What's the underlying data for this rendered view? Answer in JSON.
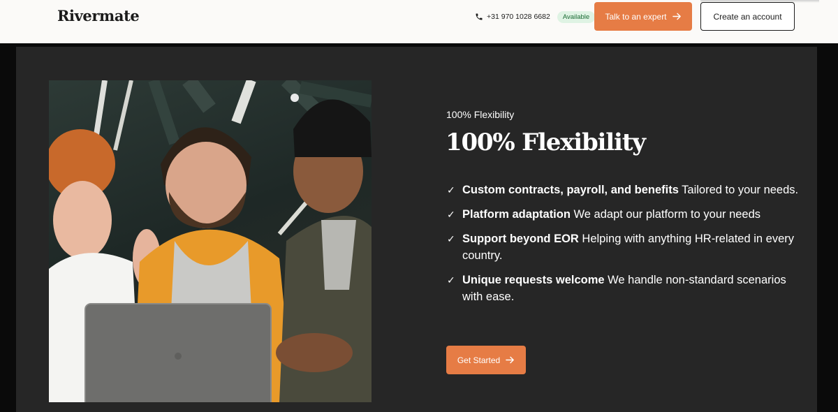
{
  "header": {
    "logo": "Rivermate",
    "phone": "+31 970 1028 6682",
    "availability": "Available",
    "cta_expert": "Talk to an expert",
    "cta_account": "Create an account"
  },
  "hero": {
    "image_alt": "Three smiling colleagues looking at a laptop",
    "eyebrow": "100% Flexibility",
    "title": "100% Flexibility",
    "features": [
      {
        "strong": "Custom contracts, payroll, and benefits",
        "text": " Tailored to your needs."
      },
      {
        "strong": "Platform adaptation",
        "text": " We adapt our platform to your needs"
      },
      {
        "strong": "Support beyond EOR",
        "text": " Helping with anything HR-related in every country."
      },
      {
        "strong": "Unique requests welcome",
        "text": " We handle non-standard scenarios with ease."
      }
    ],
    "check_symbol": "✓",
    "cta": "Get Started"
  },
  "colors": {
    "accent": "#e67c45",
    "panel": "#262626",
    "badge_bg": "#dff3e4"
  },
  "icons": {
    "phone": "phone-icon",
    "arrow": "arrow-right-icon",
    "check": "check-icon"
  }
}
